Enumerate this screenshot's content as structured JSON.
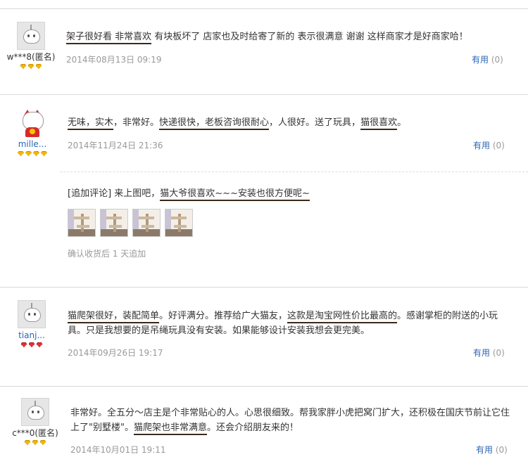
{
  "useful_label": "有用",
  "reviews": [
    {
      "username": "w***8(匿名)",
      "gem_count": 3,
      "gem_color": "gold",
      "avatar": "robot-avatar",
      "segments": [
        {
          "t": "架子很好看 非常喜欢",
          "u": true
        },
        {
          "t": " 有块板坏了 店家也及时给寄了新的 表示很满意 谢谢 这样商家才是好商家哈！",
          "u": false
        }
      ],
      "date": "2014年08月13日 09:19",
      "useful_count": "(0)"
    },
    {
      "username": "mille...",
      "gem_count": 4,
      "gem_color": "gold",
      "avatar": "lucky-cat-avatar",
      "segments": [
        {
          "t": "无味，实木",
          "u": true
        },
        {
          "t": "，非常好。",
          "u": false
        },
        {
          "t": "快递很快，老板咨询很耐心",
          "u": true
        },
        {
          "t": "，人很好。送了玩具，",
          "u": false
        },
        {
          "t": "猫很喜欢",
          "u": true
        },
        {
          "t": "。",
          "u": false
        }
      ],
      "date": "2014年11月24日 21:36",
      "useful_count": "(0)",
      "followup": {
        "segments": [
          {
            "t": "[追加评论] 来上图吧，",
            "u": false
          },
          {
            "t": "猫大爷很喜欢~~~安装也很方便呢~",
            "u": true
          }
        ],
        "thumb_count": 4,
        "note": "确认收货后 1 天追加"
      }
    },
    {
      "username": "tianj...",
      "gem_count": 3,
      "gem_color": "red",
      "avatar": "robot-avatar",
      "segments": [
        {
          "t": "猫爬架很好，装配简单",
          "u": true
        },
        {
          "t": "。好评满分。推荐给广大猫友，",
          "u": false
        },
        {
          "t": "这款是淘宝网性价比最高的",
          "u": true
        },
        {
          "t": "。感谢掌柜的附送的小玩具。只是我想要的是吊绳玩具没有安装。如果能够设计安装我想会更完美。",
          "u": false
        }
      ],
      "date": "2014年09月26日 19:17",
      "useful_count": "(0)"
    },
    {
      "username": "c***0(匿名)",
      "gem_count": 3,
      "gem_color": "gold",
      "avatar": "robot-avatar",
      "segments": [
        {
          "t": "非常好。全五分～店主是个非常贴心的人。心思很细致。帮我家胖小虎把窝门扩大，还积极在国庆节前让它住上了\"别墅楼\"。",
          "u": false
        },
        {
          "t": "猫爬架也非常满意",
          "u": true
        },
        {
          "t": "。还会介绍朋友来的！",
          "u": false
        }
      ],
      "date": "2014年10月01日 19:11",
      "useful_count": "(0)"
    }
  ]
}
